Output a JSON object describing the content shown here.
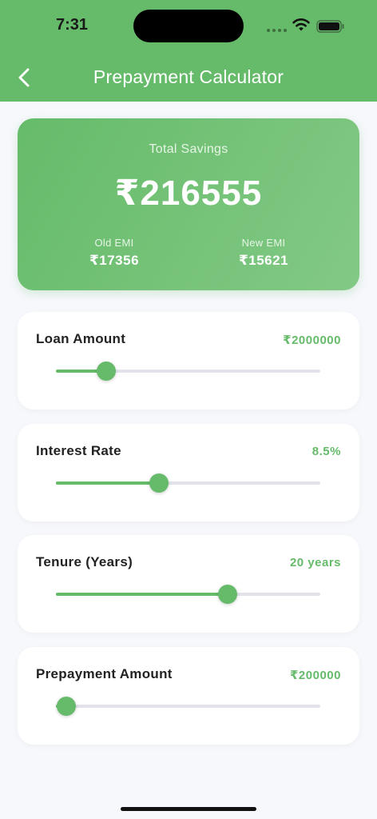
{
  "status_bar": {
    "time": "7:31"
  },
  "header": {
    "title": "Prepayment Calculator",
    "back_icon": "chevron-left-icon"
  },
  "savings": {
    "label": "Total Savings",
    "value": "₹216555",
    "old_emi_label": "Old EMI",
    "old_emi_value": "₹17356",
    "new_emi_label": "New EMI",
    "new_emi_value": "₹15621"
  },
  "sliders": [
    {
      "label": "Loan Amount",
      "value": "₹2000000",
      "fill_fraction": 0.19
    },
    {
      "label": "Interest Rate",
      "value": "8.5%",
      "fill_fraction": 0.39
    },
    {
      "label": "Tenure (Years)",
      "value": "20 years",
      "fill_fraction": 0.65
    },
    {
      "label": "Prepayment Amount",
      "value": "₹200000",
      "fill_fraction": 0.04
    }
  ],
  "colors": {
    "accent": "#66bb6a",
    "track": "#e2e2ea",
    "background": "#f7f8fc"
  }
}
